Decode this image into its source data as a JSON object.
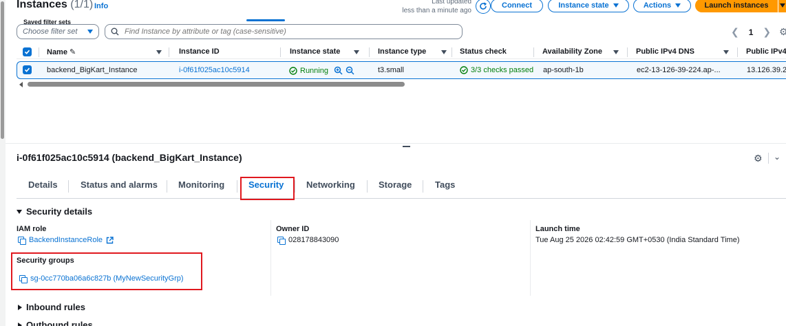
{
  "header": {
    "title": "Instances",
    "count": "(1/1)",
    "info": "Info",
    "last_updated_label": "Last updated",
    "last_updated_value": "less than a minute ago",
    "connect": "Connect",
    "instance_state": "Instance state",
    "actions": "Actions",
    "launch": "Launch instances"
  },
  "filters": {
    "saved_label": "Saved filter sets",
    "saved_placeholder": "Choose filter set",
    "search_placeholder": "Find Instance by attribute or tag (case-sensitive)",
    "page": "1"
  },
  "table": {
    "columns": [
      "Name",
      "Instance ID",
      "Instance state",
      "Instance type",
      "Status check",
      "Availability Zone",
      "Public IPv4 DNS",
      "Public IPv4"
    ],
    "row": {
      "name": "backend_BigKart_Instance",
      "instance_id": "i-0f61f025ac10c5914",
      "state": "Running",
      "type": "t3.small",
      "status_check": "3/3 checks passed",
      "az": "ap-south-1b",
      "dns": "ec2-13-126-39-224.ap-...",
      "ip": "13.126.39.2"
    }
  },
  "detail": {
    "title": "i-0f61f025ac10c5914 (backend_BigKart_Instance)",
    "tabs": [
      "Details",
      "Status and alarms",
      "Monitoring",
      "Security",
      "Networking",
      "Storage",
      "Tags"
    ],
    "active_tab": "Security",
    "security_details": "Security details",
    "iam_role_label": "IAM role",
    "iam_role_value": "BackendInstanceRole",
    "owner_id_label": "Owner ID",
    "owner_id_value": "028178843090",
    "launch_time_label": "Launch time",
    "launch_time_value": "Tue Aug 25 2026 02:42:59 GMT+0530 (India Standard Time)",
    "security_groups_label": "Security groups",
    "security_groups_value": "sg-0cc770ba06a6c827b (MyNewSecurityGrp)",
    "inbound_rules": "Inbound rules",
    "outbound_rules": "Outbound rules"
  },
  "colors": {
    "accent": "#0972d3",
    "primary_button": "#ff9900",
    "success": "#037f0c",
    "highlight_box": "#e0181e"
  }
}
